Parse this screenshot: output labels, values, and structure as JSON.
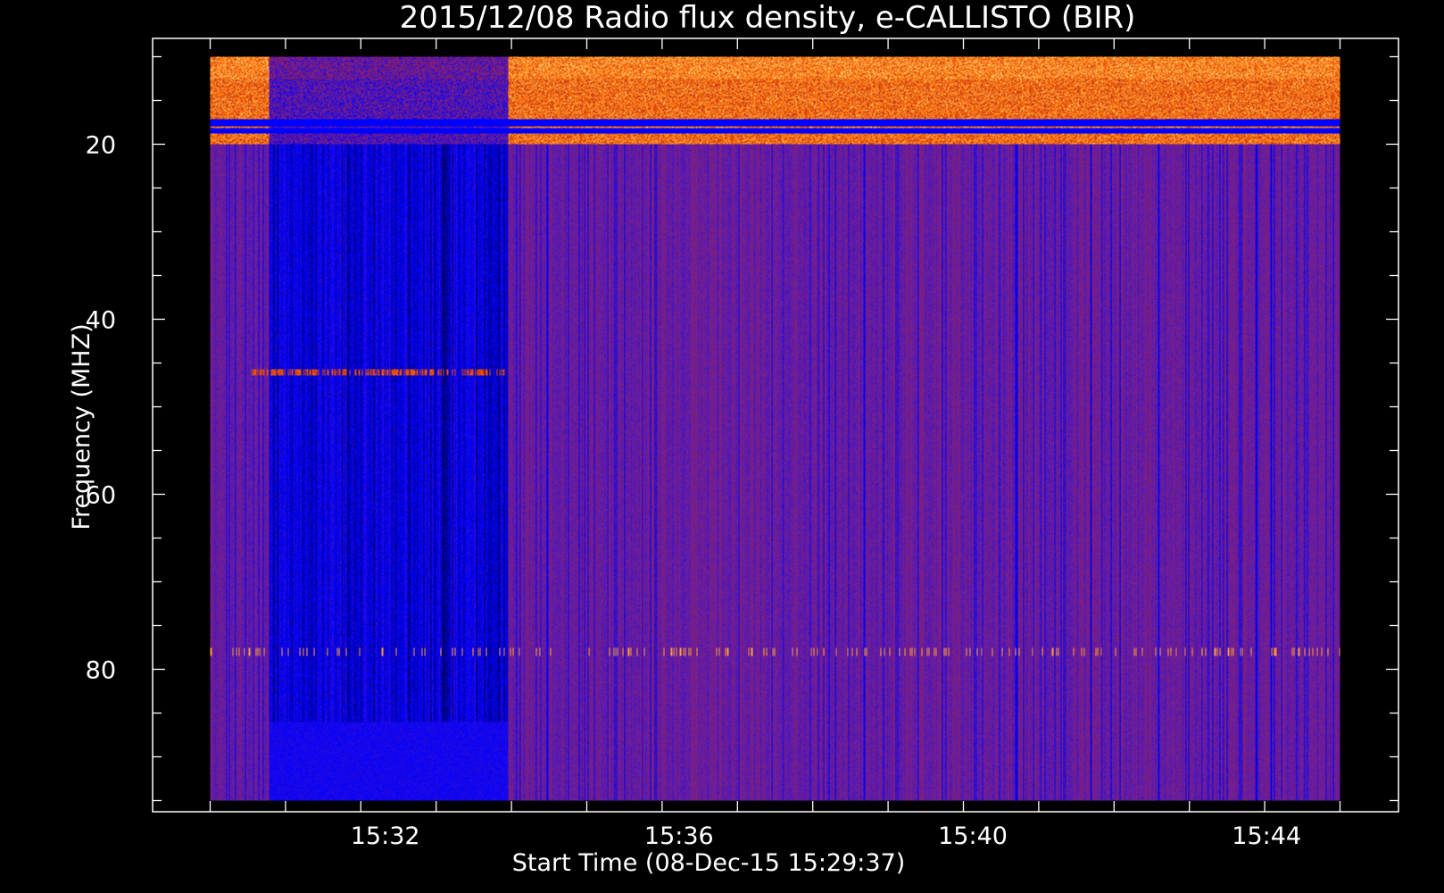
{
  "chart_data": {
    "type": "heatmap",
    "title": "2015/12/08  Radio flux density, e-CALLISTO (BIR)",
    "xlabel": "Start Time (08-Dec-15 15:29:37)",
    "ylabel": "Frequency (MHZ)",
    "x_tick_labels": [
      "15:32",
      "15:36",
      "15:40",
      "15:44"
    ],
    "y_tick_labels": [
      "20",
      "40",
      "60",
      "80"
    ],
    "x_start": "15:29:37",
    "x_range": [
      "15:29:37",
      "15:45:00"
    ],
    "y_range_mhz": [
      10,
      95
    ],
    "y_axis_inverted": true,
    "grid": false,
    "colors": {
      "background": "#000000",
      "axes": "#ffffff",
      "colormap": [
        "#000000",
        "#0000ff",
        "#6a1fa0",
        "#b0201e",
        "#ff6a00",
        "#ffd26b"
      ]
    },
    "features": [
      {
        "kind": "broadband-interference-band",
        "freq_mhz": [
          10,
          20
        ],
        "intensity": "high"
      },
      {
        "kind": "narrowband-line",
        "freq_mhz": 78,
        "intensity": "high-intermittent"
      },
      {
        "kind": "narrowband-line",
        "freq_mhz": 46,
        "time_range": [
          "15:30:10",
          "15:33:37"
        ],
        "intensity": "medium"
      },
      {
        "kind": "low-signal-region",
        "time_range": [
          "15:30:25",
          "15:33:40"
        ]
      }
    ]
  }
}
